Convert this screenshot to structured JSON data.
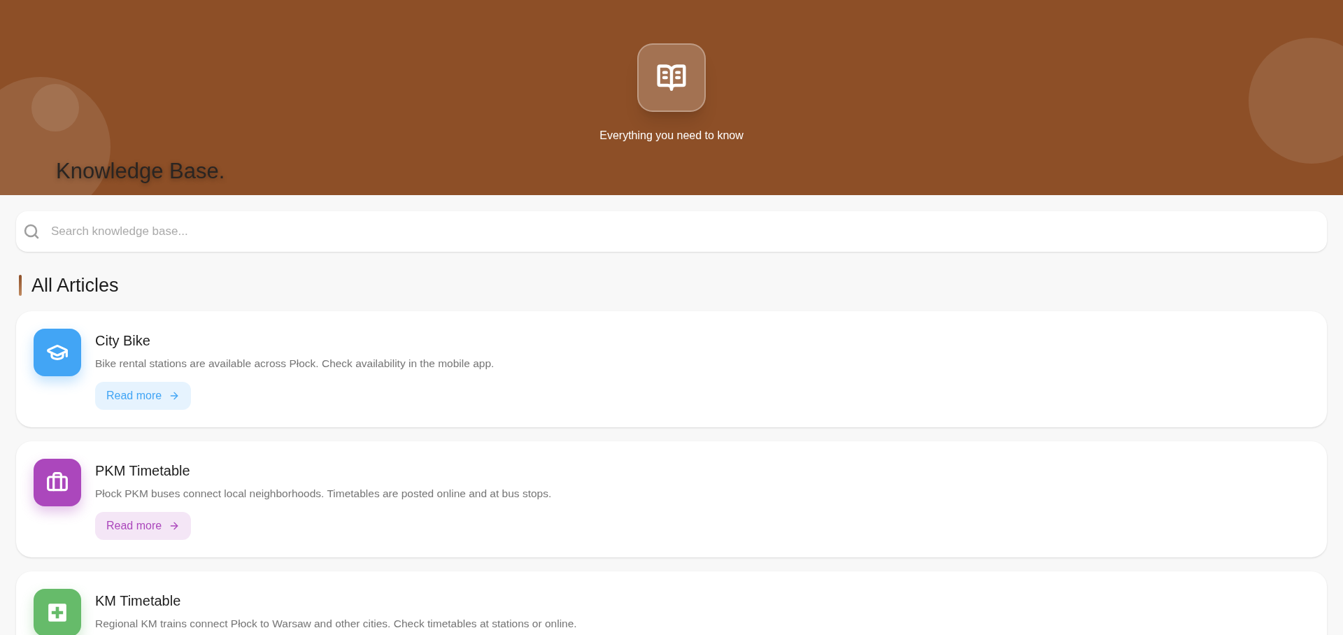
{
  "header": {
    "title": "Knowledge Base.",
    "subtitle": "Everything you need to know"
  },
  "search": {
    "placeholder": "Search knowledge base..."
  },
  "section": {
    "title": "All Articles"
  },
  "articles": [
    {
      "title": "City Bike",
      "description": "Bike rental stations are available across Płock. Check availability in the mobile app.",
      "kind": "graduation",
      "color": "#42a5f5",
      "link": "Read more"
    },
    {
      "title": "PKM Timetable",
      "description": "Płock PKM buses connect local neighborhoods. Timetables are posted online and at bus stops.",
      "kind": "briefcase",
      "color": "#ab47bc",
      "link": "Read more"
    },
    {
      "title": "KM Timetable",
      "description": "Regional KM trains connect Płock to Warsaw and other cities. Check timetables at stations or online.",
      "kind": "medical",
      "color": "#66bb6a"
    }
  ]
}
